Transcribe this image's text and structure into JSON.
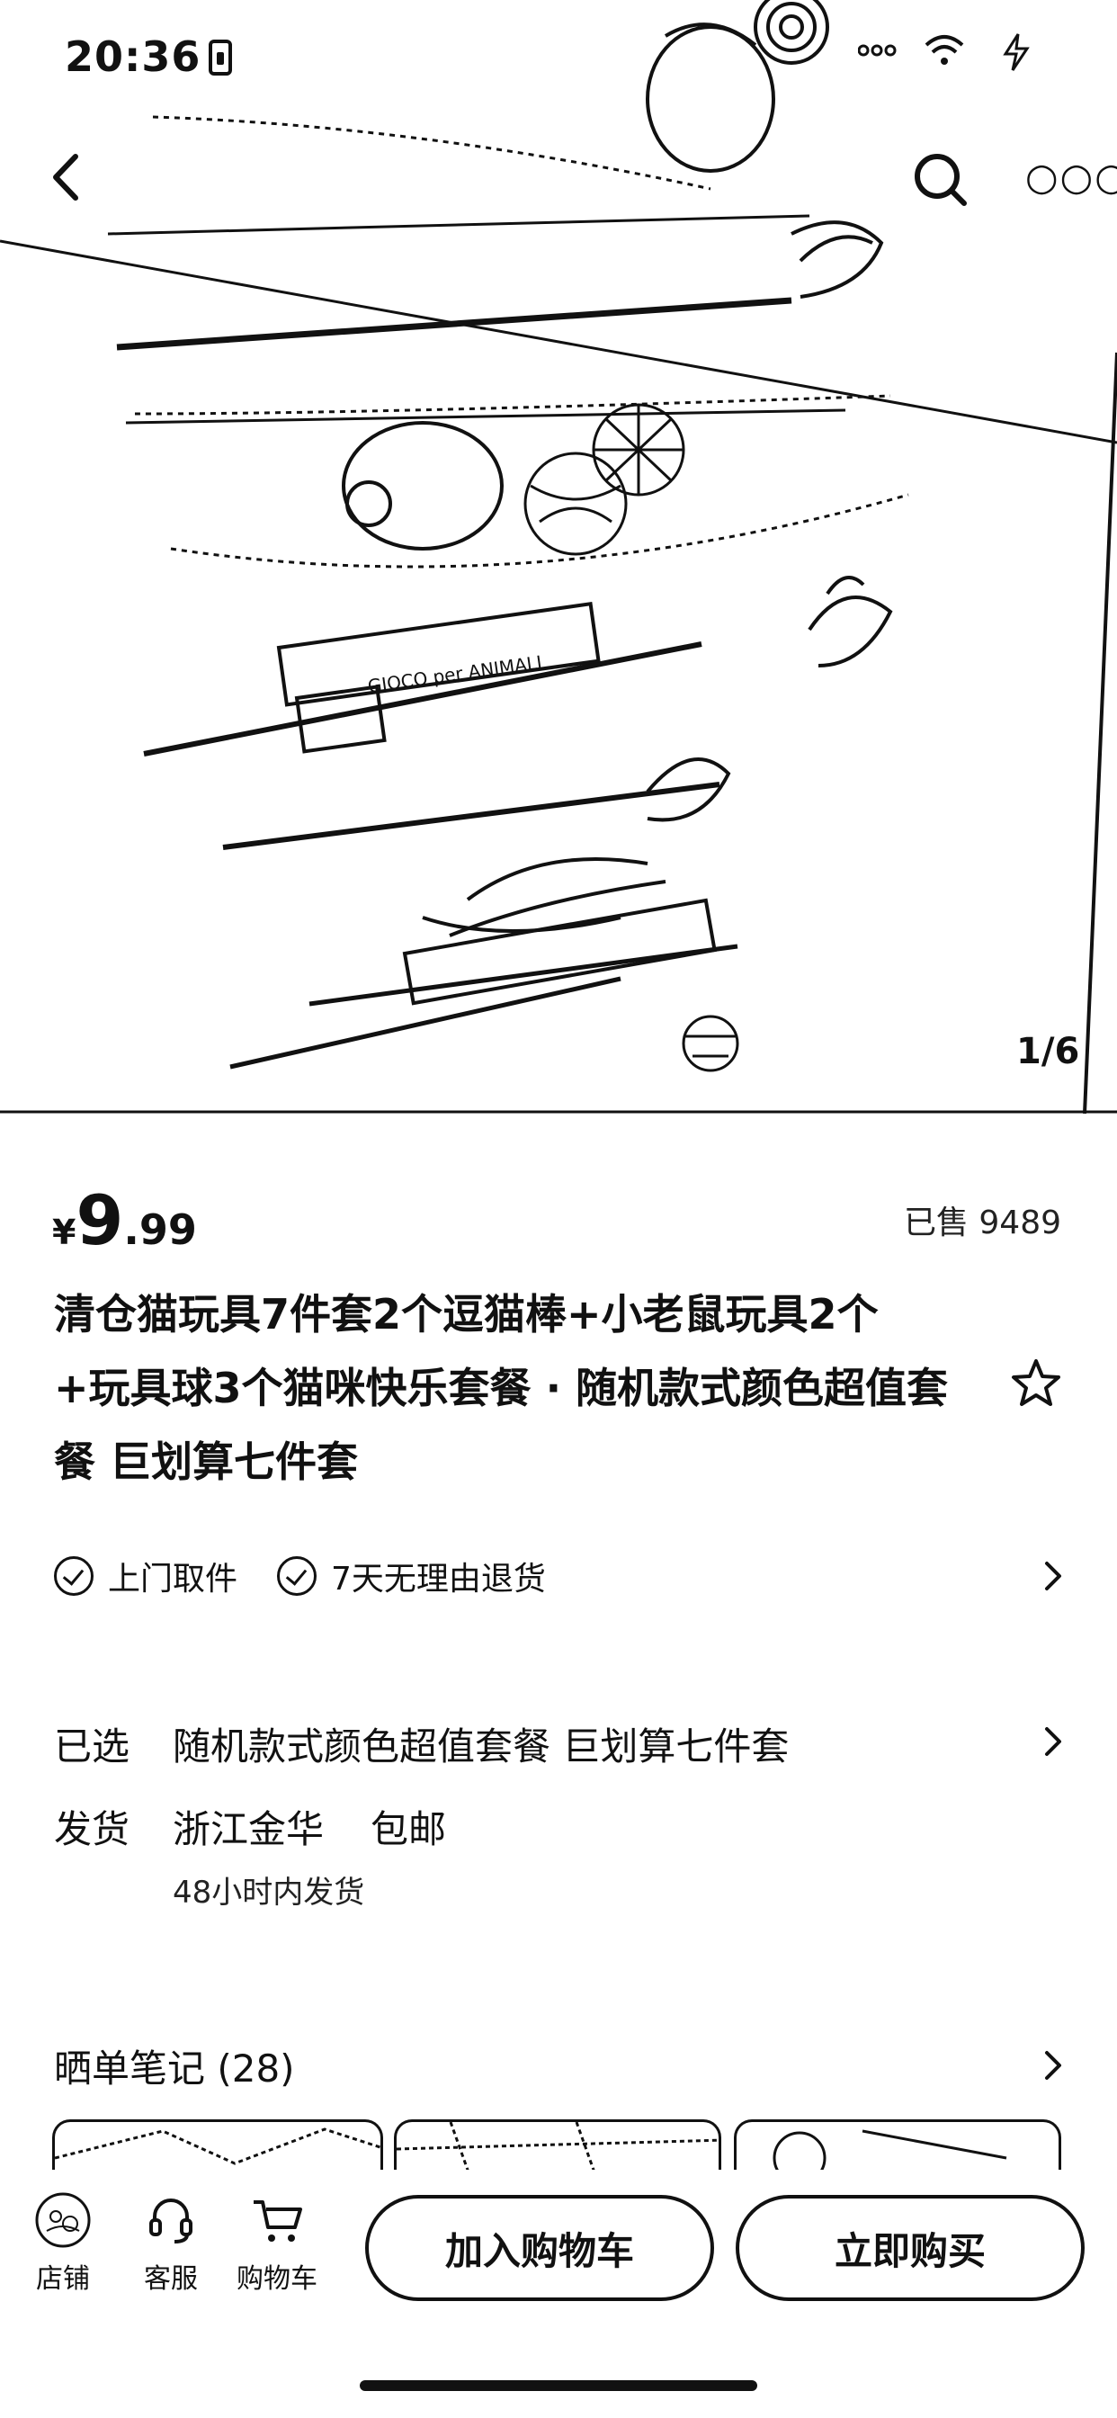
{
  "status_bar": {
    "time": "20:36",
    "signal_icon": "signal-dots-icon",
    "wifi_icon": "wifi-icon",
    "battery_icon": "battery-charging-icon"
  },
  "nav": {
    "back_icon": "back-arrow-icon",
    "search_icon": "search-icon",
    "more_label": "○○○"
  },
  "gallery": {
    "counter": "1/6"
  },
  "product": {
    "currency": "¥",
    "price_int": "9",
    "price_dec": ".99",
    "sold": "已售 9489",
    "title": "清仓猫玩具7件套2个逗猫棒+小老鼠玩具2个+玩具球3个猫咪快乐套餐 · 随机款式颜色超值套餐 巨划算七件套"
  },
  "services": [
    {
      "label": "上门取件"
    },
    {
      "label": "7天无理由退货"
    }
  ],
  "selection": {
    "key": "已选",
    "value": "随机款式颜色超值套餐 巨划算七件套"
  },
  "shipping": {
    "key": "发货",
    "origin": "浙江金华",
    "fee": "包邮",
    "time": "48小时内发货"
  },
  "notes": {
    "title": "晒单笔记 (28)"
  },
  "bottom_bar": {
    "store": "店铺",
    "service": "客服",
    "cart": "购物车",
    "add_to_cart": "加入购物车",
    "buy_now": "立即购买"
  }
}
